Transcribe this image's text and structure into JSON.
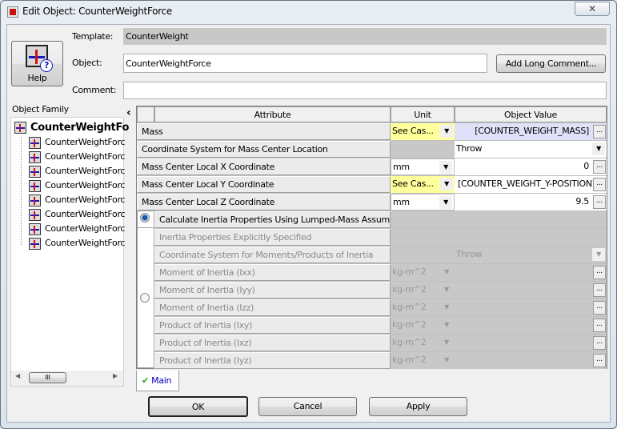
{
  "window": {
    "title": "Edit Object: CounterWeightForce",
    "close_glyph": "✕"
  },
  "header": {
    "help_label": "Help",
    "template_label": "Template:",
    "template_value": "CounterWeight",
    "object_label": "Object:",
    "object_value": "CounterWeightForce",
    "comment_label": "Comment:",
    "comment_value": "",
    "add_long_comment": "Add Long Comment..."
  },
  "family": {
    "label": "Object Family",
    "root": "CounterWeightFo",
    "children": [
      "CounterWeightForc",
      "CounterWeightForc",
      "CounterWeightForc",
      "CounterWeightForc",
      "CounterWeightForc",
      "CounterWeightForc",
      "CounterWeightForc",
      "CounterWeightForc"
    ],
    "scroll_grip": "III"
  },
  "grid": {
    "headers": {
      "attribute": "Attribute",
      "unit": "Unit",
      "value": "Object Value"
    },
    "rows": [
      {
        "attribute": "Mass",
        "unit": "See Cas...",
        "value": "[COUNTER_WEIGHT_MASS]"
      },
      {
        "attribute": "Coordinate System for Mass Center Location",
        "unit": "",
        "value": "Throw"
      },
      {
        "attribute": "Mass Center Local X Coordinate",
        "unit": "mm",
        "value": "0"
      },
      {
        "attribute": "Mass Center Local Y Coordinate",
        "unit": "See Cas...",
        "value": "[COUNTER_WEIGHT_Y-POSITION]"
      },
      {
        "attribute": "Mass Center Local Z Coordinate",
        "unit": "mm",
        "value": "9.5"
      },
      {
        "attribute": "Calculate Inertia Properties Using Lumped-Mass Assumpt...",
        "unit": "",
        "value": ""
      },
      {
        "attribute": "Inertia Properties Explicitly Specified",
        "unit": "",
        "value": ""
      },
      {
        "attribute": "Coordinate System for Moments/Products of Inertia",
        "unit": "",
        "value": "Throw"
      },
      {
        "attribute": "Moment of Inertia (Ixx)",
        "unit": "kg-m^2",
        "value": ""
      },
      {
        "attribute": "Moment of Inertia (Iyy)",
        "unit": "kg-m^2",
        "value": ""
      },
      {
        "attribute": "Moment of Inertia (Izz)",
        "unit": "kg-m^2",
        "value": ""
      },
      {
        "attribute": "Product of Inertia (Ixy)",
        "unit": "kg-m^2",
        "value": ""
      },
      {
        "attribute": "Product of Inertia (Ixz)",
        "unit": "kg-m^2",
        "value": ""
      },
      {
        "attribute": "Product of Inertia (Iyz)",
        "unit": "kg-m^2",
        "value": ""
      }
    ],
    "selected_option": "Calculate Inertia Properties Using Lumped-Mass Assumpt..."
  },
  "tabs": [
    {
      "label": "Main",
      "active": true
    }
  ],
  "buttons": {
    "ok": "OK",
    "cancel": "Cancel",
    "apply": "Apply",
    "ellipsis": "...",
    "collapse": "‹"
  },
  "colors": {
    "highlight_yellow": "#ffff9c",
    "value_lavender": "#e0e0f8",
    "tab_text": "#0000c0"
  }
}
